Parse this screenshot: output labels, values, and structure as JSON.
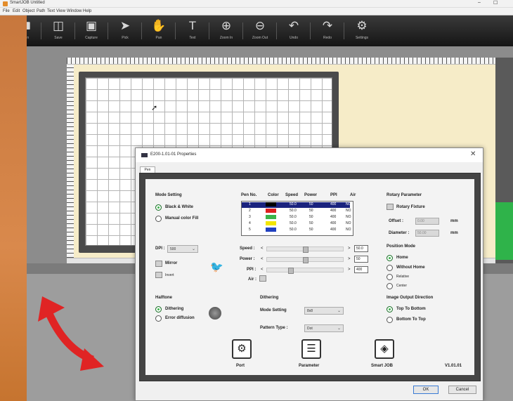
{
  "app": {
    "title": "SmartJOB Untitled",
    "window_controls": [
      "–",
      "☐"
    ]
  },
  "menu": [
    "File",
    "Edit",
    "Object",
    "Path",
    "Text",
    "View",
    "Window",
    "Help"
  ],
  "toolbar": [
    {
      "label": "Open",
      "icon": "folder-icon"
    },
    {
      "label": "Save",
      "icon": "save-icon"
    },
    {
      "label": "Capture",
      "icon": "camera-icon"
    },
    {
      "label": "Pick",
      "icon": "pointer-icon"
    },
    {
      "label": "Pan",
      "icon": "hand-icon"
    },
    {
      "label": "Text",
      "icon": "text-icon"
    },
    {
      "label": "Zoom In",
      "icon": "zoom-in-icon"
    },
    {
      "label": "Zoom Out",
      "icon": "zoom-out-icon"
    },
    {
      "label": "Undo",
      "icon": "undo-icon"
    },
    {
      "label": "Redo",
      "icon": "redo-icon"
    },
    {
      "label": "Settings",
      "icon": "gear-icon"
    }
  ],
  "dialog": {
    "title": "E200-1.01-01 Properties",
    "tab": "Pen",
    "mode_setting": {
      "title": "Mode Setting",
      "options": [
        "Black & White",
        "Manual color Fill"
      ],
      "selected": 0
    },
    "dpi": {
      "label": "DPI :",
      "value": "500"
    },
    "mirror_label": "Mirror",
    "invert_label": "Invert",
    "pen_table": {
      "headers": [
        "Pen No.",
        "Color",
        "Speed",
        "Power",
        "PPI",
        "Air"
      ],
      "rows": [
        {
          "no": "1",
          "color": "#000000",
          "speed": "50.0",
          "power": "50",
          "ppi": "400",
          "air": "NO"
        },
        {
          "no": "2",
          "color": "#e02020",
          "speed": "50.0",
          "power": "50",
          "ppi": "400",
          "air": "NO"
        },
        {
          "no": "3",
          "color": "#3cb44a",
          "speed": "50.0",
          "power": "50",
          "ppi": "400",
          "air": "NO"
        },
        {
          "no": "4",
          "color": "#f2e500",
          "speed": "50.0",
          "power": "50",
          "ppi": "400",
          "air": "NO"
        },
        {
          "no": "5",
          "color": "#2040c0",
          "speed": "50.0",
          "power": "50",
          "ppi": "400",
          "air": "NO"
        }
      ],
      "selected_row": 0
    },
    "speed": {
      "label": "Speed :",
      "value": "50.0",
      "fraction": 0.5
    },
    "power": {
      "label": "Power :",
      "value": "50",
      "fraction": 0.5
    },
    "ppi": {
      "label": "PPI :",
      "value": "400",
      "fraction": 0.3
    },
    "air_label": "Air :",
    "rotary": {
      "title": "Rotary Parameter",
      "fixture_label": "Rotary Fixture",
      "offset_label": "Offset :",
      "offset_value": "0.00",
      "diameter_label": "Diameter :",
      "diameter_value": "50.00",
      "unit": "mm"
    },
    "position_mode": {
      "title": "Position Mode",
      "options": [
        "Home",
        "Without Home",
        "Relative",
        "Center"
      ],
      "selected": 0
    },
    "halftone": {
      "title": "Halftone",
      "options": [
        "Dithering",
        "Error diffusion"
      ],
      "selected": 0
    },
    "dithering": {
      "title": "Dithering",
      "mode_label": "Mode Setting",
      "mode_value": "8x8",
      "pattern_label": "Pattern Type :",
      "pattern_value": "Dot"
    },
    "image_output": {
      "title": "Image Output Direction",
      "options": [
        "Top To Bottom",
        "Bottom To Top"
      ],
      "selected": 0
    },
    "buttons": [
      {
        "label": "Port",
        "icon": "port-gear-icon"
      },
      {
        "label": "Parameter",
        "icon": "sliders-icon"
      },
      {
        "label": "Smart JOB",
        "icon": "smartjob-icon"
      }
    ],
    "version": "V1.01.01",
    "ok_label": "OK",
    "cancel_label": "Cancel"
  },
  "colors": {
    "accent": "#3ab54a",
    "arrow": "#e02424",
    "selected_row": "#1a237e"
  }
}
